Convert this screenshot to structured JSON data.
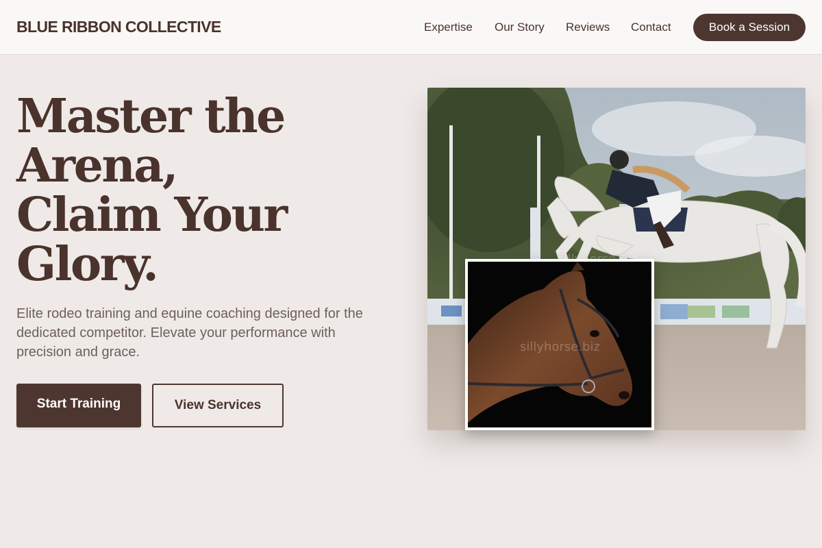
{
  "header": {
    "brand": "BLUE RIBBON COLLECTIVE",
    "nav": [
      "Expertise",
      "Our Story",
      "Reviews",
      "Contact"
    ],
    "cta": "Book a Session"
  },
  "hero": {
    "title_lines": [
      "Master the",
      "Arena,",
      "Claim Your",
      "Glory."
    ],
    "subtitle": "Elite rodeo training and equine coaching designed for the dedicated competitor. Elevate your performance with precision and grace.",
    "primary_button": "Start Training",
    "secondary_button": "View Services"
  },
  "images": {
    "main": {
      "watermark": "sillyhorse.biz"
    },
    "inset": {
      "watermark": "sillyhorse.biz"
    }
  },
  "colors": {
    "primary": "#4e3630",
    "background": "#efeae8",
    "header_bg": "#f9f8f7",
    "text": "#4a332c",
    "muted_text": "#6e5f5a"
  }
}
